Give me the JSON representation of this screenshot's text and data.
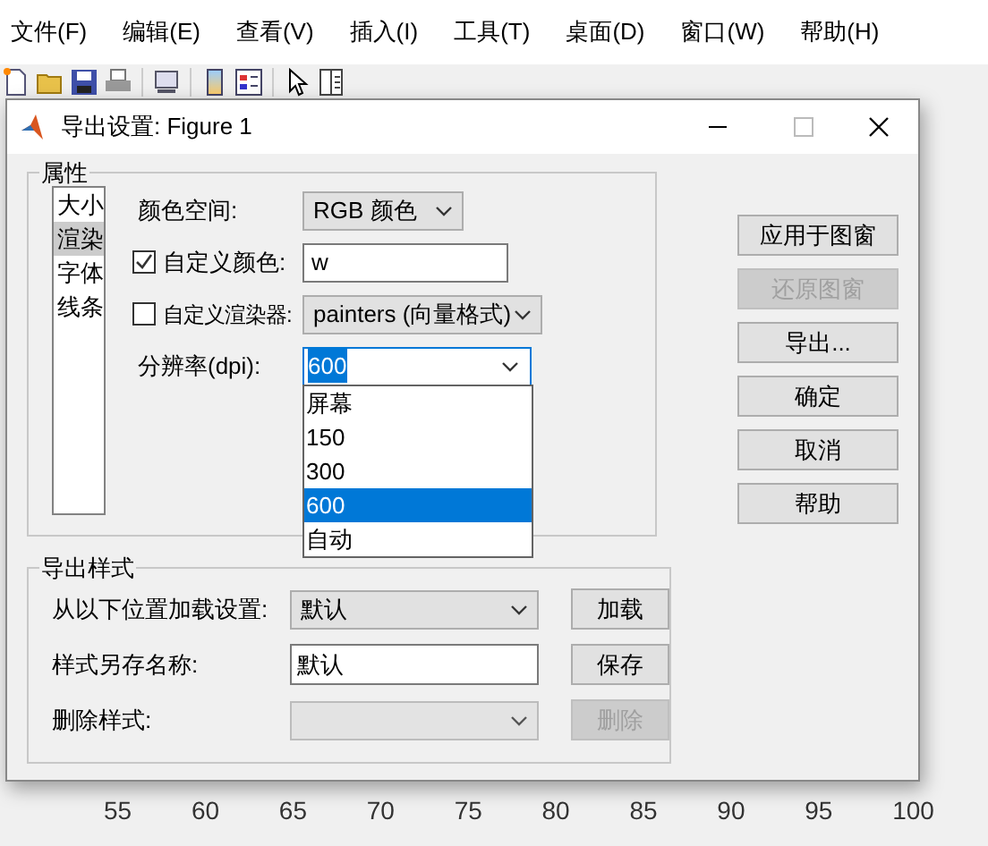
{
  "menu_bar": [
    {
      "label": "文件(F)"
    },
    {
      "label": "编辑(E)"
    },
    {
      "label": "查看(V)"
    },
    {
      "label": "插入(I)"
    },
    {
      "label": "工具(T)"
    },
    {
      "label": "桌面(D)"
    },
    {
      "label": "窗口(W)"
    },
    {
      "label": "帮助(H)"
    }
  ],
  "axis": {
    "x_tick_labels": [
      "55",
      "60",
      "65",
      "70",
      "75",
      "80",
      "85",
      "90",
      "95",
      "100"
    ]
  },
  "dialog": {
    "title": "导出设置: Figure 1",
    "properties_group": {
      "label": "属性",
      "categories": [
        {
          "label": "大小",
          "selected": false
        },
        {
          "label": "渲染",
          "selected": true
        },
        {
          "label": "字体",
          "selected": false
        },
        {
          "label": "线条",
          "selected": false
        }
      ],
      "color_space": {
        "label": "颜色空间:",
        "value": "RGB 颜色"
      },
      "custom_color": {
        "label": "自定义颜色:",
        "checked": true,
        "value": "w"
      },
      "custom_renderer": {
        "label": "自定义渲染器:",
        "checked": false,
        "value": "painters (向量格式)"
      },
      "resolution": {
        "label": "分辨率(dpi):",
        "value": "600",
        "expanded": true,
        "options": [
          {
            "label": "屏幕",
            "selected": false
          },
          {
            "label": "150",
            "selected": false
          },
          {
            "label": "300",
            "selected": false
          },
          {
            "label": "600",
            "selected": true
          },
          {
            "label": "自动",
            "selected": false
          }
        ]
      }
    },
    "buttons": [
      {
        "label": "应用于图窗",
        "disabled": false
      },
      {
        "label": "还原图窗",
        "disabled": true
      },
      {
        "label": "导出...",
        "disabled": false
      },
      {
        "label": "确定",
        "disabled": false
      },
      {
        "label": "取消",
        "disabled": false
      },
      {
        "label": "帮助",
        "disabled": false
      }
    ],
    "style_group": {
      "label": "导出样式",
      "load": {
        "label": "从以下位置加载设置:",
        "value": "默认",
        "disabled": false,
        "button": {
          "label": "加载",
          "disabled": false
        }
      },
      "save_as": {
        "label": "样式另存名称:",
        "value": "默认",
        "button": {
          "label": "保存",
          "disabled": false
        }
      },
      "delete": {
        "label": "删除样式:",
        "disabled": true,
        "button": {
          "label": "删除",
          "disabled": true
        }
      }
    }
  }
}
